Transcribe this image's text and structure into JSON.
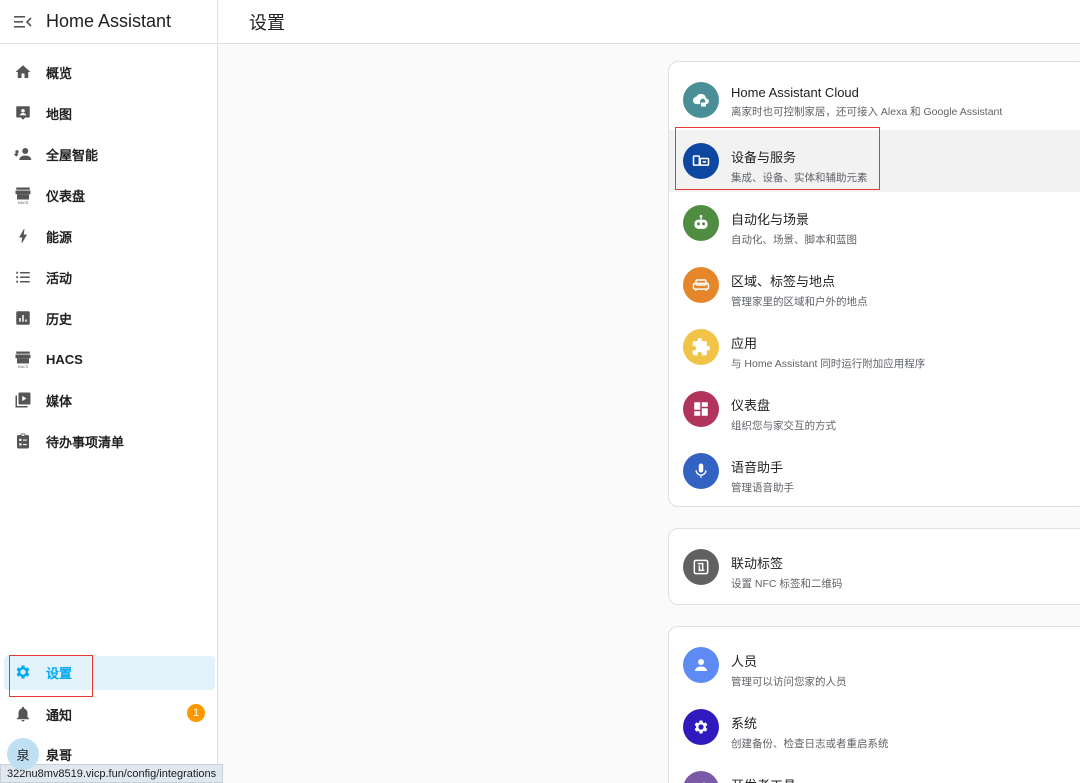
{
  "app": {
    "title": "Home Assistant"
  },
  "header": {
    "title": "设置"
  },
  "sidebar": {
    "items": [
      {
        "label": "概览",
        "icon": "home-icon"
      },
      {
        "label": "地图",
        "icon": "map-icon"
      },
      {
        "label": "全屋智能",
        "icon": "people-icon"
      },
      {
        "label": "仪表盘",
        "icon": "hacs-store-icon"
      },
      {
        "label": "能源",
        "icon": "lightning-icon"
      },
      {
        "label": "活动",
        "icon": "list-icon"
      },
      {
        "label": "历史",
        "icon": "chart-icon"
      },
      {
        "label": "HACS",
        "icon": "hacs-store-icon"
      },
      {
        "label": "媒体",
        "icon": "media-icon"
      },
      {
        "label": "待办事项清单",
        "icon": "clipboard-icon"
      }
    ],
    "settings": {
      "label": "设置",
      "icon": "gear-icon"
    },
    "notifications": {
      "label": "通知",
      "badge": "1",
      "icon": "bell-icon"
    },
    "user": {
      "label": "泉哥",
      "avatar_text": "泉"
    }
  },
  "settings_cards": {
    "card1": [
      {
        "title": "Home Assistant Cloud",
        "subtitle": "离家时也可控制家居，还可接入 Alexa 和 Google Assistant",
        "color": "#4a8e98",
        "icon": "cloud-lock-icon"
      },
      {
        "title": "设备与服务",
        "subtitle": "集成、设备、实体和辅助元素",
        "color": "#0d47a1",
        "icon": "devices-icon"
      },
      {
        "title": "自动化与场景",
        "subtitle": "自动化、场景、脚本和蓝图",
        "color": "#518c43",
        "icon": "robot-icon"
      },
      {
        "title": "区域、标签与地点",
        "subtitle": "管理家里的区域和户外的地点",
        "color": "#e48629",
        "icon": "sofa-icon"
      },
      {
        "title": "应用",
        "subtitle": "与 Home Assistant 同时运行附加应用程序",
        "color": "#f1c447",
        "icon": "puzzle-icon"
      },
      {
        "title": "仪表盘",
        "subtitle": "组织您与家交互的方式",
        "color": "#b1345c",
        "icon": "dashboard-icon"
      },
      {
        "title": "语音助手",
        "subtitle": "管理语音助手",
        "color": "#3263c3",
        "icon": "microphone-icon"
      }
    ],
    "card2": [
      {
        "title": "联动标签",
        "subtitle": "设置 NFC 标签和二维码",
        "color": "#616161",
        "icon": "nfc-icon"
      }
    ],
    "card3": [
      {
        "title": "人员",
        "subtitle": "管理可以访问您家的人员",
        "color": "#5e8af4",
        "icon": "person-icon"
      },
      {
        "title": "系统",
        "subtitle": "创建备份、检查日志或者重启系统",
        "color": "#301abe",
        "icon": "gear-icon"
      },
      {
        "title": "开发者工具",
        "color": "#7a5aa8",
        "icon": "wrench-icon"
      }
    ]
  },
  "status_url": "322nu8mv8519.vicp.fun/config/integrations",
  "colors": {
    "accent": "#03a9f4",
    "annotation": "#e53935"
  }
}
